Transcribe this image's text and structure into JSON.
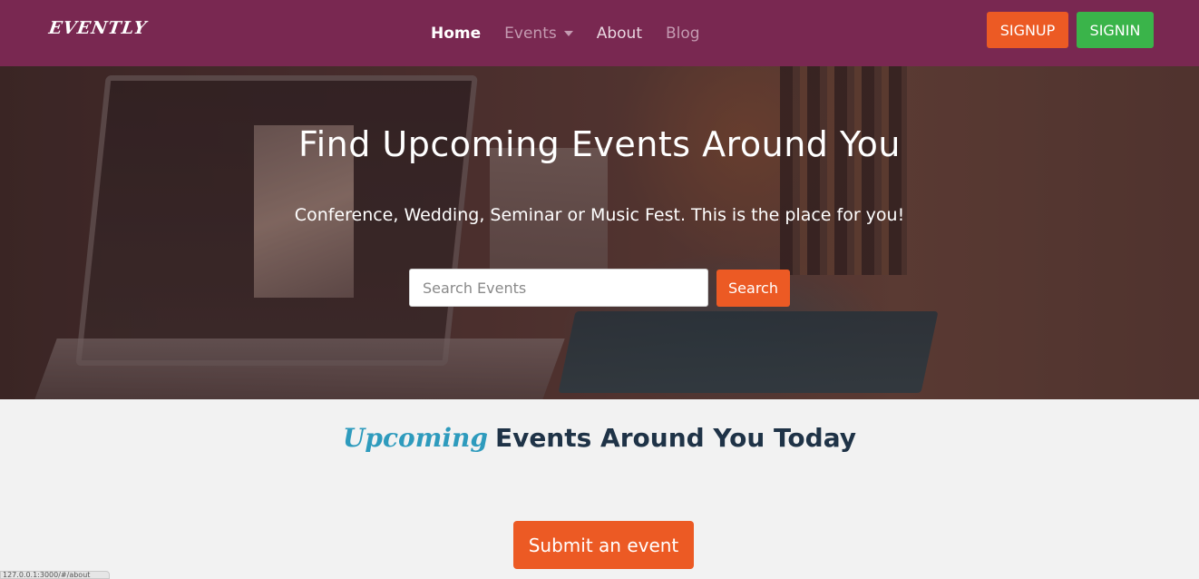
{
  "brand": {
    "logo_text": "EVENTLY"
  },
  "nav": {
    "items": [
      {
        "label": "Home",
        "state": "active"
      },
      {
        "label": "Events",
        "state": "dropdown"
      },
      {
        "label": "About",
        "state": "normal"
      },
      {
        "label": "Blog",
        "state": "muted"
      }
    ],
    "signup_label": "SIGNUP",
    "signin_label": "SIGNIN"
  },
  "hero": {
    "title": "Find Upcoming Events Around You",
    "subtitle": "Conference, Wedding, Seminar or Music Fest. This is the place for you!",
    "search_placeholder": "Search Events",
    "search_value": "",
    "search_button": "Search"
  },
  "upcoming": {
    "title_accent": "Upcoming",
    "title_rest": "Events Around You Today",
    "submit_label": "Submit an event"
  },
  "status_bar": {
    "text": "127.0.0.1:3000/#/about"
  },
  "colors": {
    "navbar": "#792851",
    "orange": "#ec5a24",
    "green": "#3ab44a",
    "accent_blue": "#2e9bbd",
    "page_bg": "#f2f2f2"
  }
}
